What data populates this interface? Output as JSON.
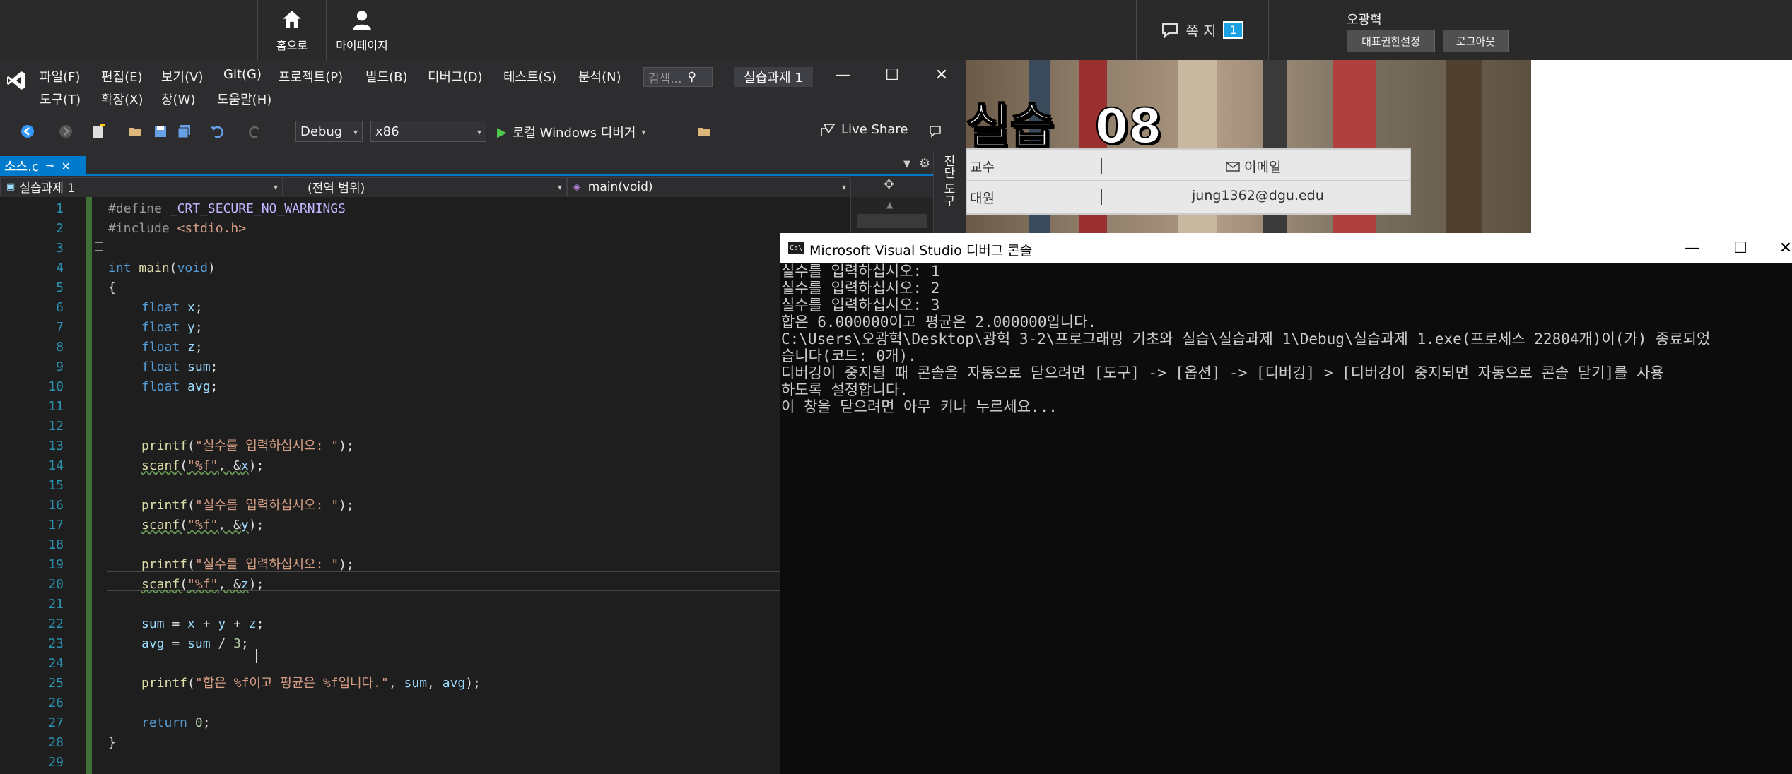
{
  "portal": {
    "nav_home": "홈으로",
    "nav_mypage": "마이페이지",
    "messages_label": "쪽 지",
    "messages_count": "1",
    "user_name": "오광혁",
    "btn_role": "대표권한설정",
    "btn_logout": "로그아웃",
    "banner_title": "실습 _08",
    "info_row1_label": "교수",
    "info_row1_value": "이메일",
    "info_row2_label": "대원",
    "info_row2_value": "jung1362@dgu.edu"
  },
  "vs": {
    "menu_row1": [
      "파일(F)",
      "편집(E)",
      "보기(V)",
      "Git(G)",
      "프로젝트(P)",
      "빌드(B)",
      "디버그(D)",
      "테스트(S)",
      "분석(N)"
    ],
    "menu_row2": [
      "도구(T)",
      "확장(X)",
      "창(W)",
      "도움말(H)"
    ],
    "search_placeholder": "검색...",
    "solution_title": "실습과제 1",
    "config": "Debug",
    "platform": "x86",
    "run_label": "로컬 Windows 디버거",
    "live_share": "Live Share",
    "doc_tab": "소스.c",
    "side_label": "진단 도구",
    "nav_project": "실습과제 1",
    "nav_scope": "(전역 범위)",
    "nav_member": "main(void)",
    "line_numbers": [
      "1",
      "2",
      "3",
      "4",
      "5",
      "6",
      "7",
      "8",
      "9",
      "10",
      "11",
      "12",
      "13",
      "14",
      "15",
      "16",
      "17",
      "18",
      "19",
      "20",
      "21",
      "22",
      "23",
      "24",
      "25",
      "26",
      "27",
      "28",
      "29"
    ],
    "code": {
      "l1a": "#define ",
      "l1b": "_CRT_SECURE_NO_WARNINGS",
      "l2a": "#include ",
      "l2b": "<stdio.h>",
      "l4a": "int ",
      "l4b": "main",
      "l4c": "(",
      "l4d": "void",
      "l4e": ")",
      "l5": "{",
      "l6a": "float ",
      "l6b": "x",
      "l6c": ";",
      "l7a": "float ",
      "l7b": "y",
      "l7c": ";",
      "l8a": "float ",
      "l8b": "z",
      "l8c": ";",
      "l9a": "float ",
      "l9b": "sum",
      "l9c": ";",
      "l10a": "float ",
      "l10b": "avg",
      "l10c": ";",
      "l13a": "printf",
      "l13b": "(",
      "l13c": "\"실수를 입력하십시오: \"",
      "l13d": ");",
      "l14a": "scanf",
      "l14b": "(",
      "l14c": "\"%f\"",
      "l14d": ", &",
      "l14e": "x",
      "l14f": ");",
      "l16a": "printf",
      "l16b": "(",
      "l16c": "\"실수를 입력하십시오: \"",
      "l16d": ");",
      "l17a": "scanf",
      "l17b": "(",
      "l17c": "\"%f\"",
      "l17d": ", &",
      "l17e": "y",
      "l17f": ");",
      "l19a": "printf",
      "l19b": "(",
      "l19c": "\"실수를 입력하십시오: \"",
      "l19d": ");",
      "l20a": "scanf",
      "l20b": "(",
      "l20c": "\"%f\"",
      "l20d": ", &",
      "l20e": "z",
      "l20f": ");",
      "l22a": "sum",
      "l22b": " = ",
      "l22c": "x",
      "l22d": " + ",
      "l22e": "y",
      "l22f": " + ",
      "l22g": "z",
      "l22h": ";",
      "l23a": "avg",
      "l23b": " = ",
      "l23c": "sum",
      "l23d": " / ",
      "l23e": "3",
      "l23f": ";",
      "l25a": "printf",
      "l25b": "(",
      "l25c": "\"합은 %f이고 평균은 %f입니다.\"",
      "l25d": ", ",
      "l25e": "sum",
      "l25f": ", ",
      "l25g": "avg",
      "l25h": ");",
      "l27a": "return ",
      "l27b": "0",
      "l27c": ";",
      "l28": "}"
    }
  },
  "console": {
    "title": "Microsoft Visual Studio 디버그 콘솔",
    "lines": [
      "실수를 입력하십시오: 1",
      "실수를 입력하십시오: 2",
      "실수를 입력하십시오: 3",
      "합은 6.000000이고 평균은 2.000000입니다.",
      "C:\\Users\\오광혁\\Desktop\\광혁 3-2\\프로그래밍 기초와 실습\\실습과제 1\\Debug\\실습과제 1.exe(프로세스 22804개)이(가) 종료되었",
      "습니다(코드: 0개).",
      "디버깅이 중지될 때 콘솔을 자동으로 닫으려면 [도구] -> [옵션] -> [디버깅] > [디버깅이 중지되면 자동으로 콘솔 닫기]를 사용",
      "하도록 설정합니다.",
      "이 창을 닫으려면 아무 키나 누르세요..."
    ]
  },
  "colors": {
    "vs_accent": "#007acc",
    "editor_bg": "#1e1e1e",
    "keyword": "#569cd6",
    "string": "#d69d85",
    "line_number": "#2b91af"
  }
}
